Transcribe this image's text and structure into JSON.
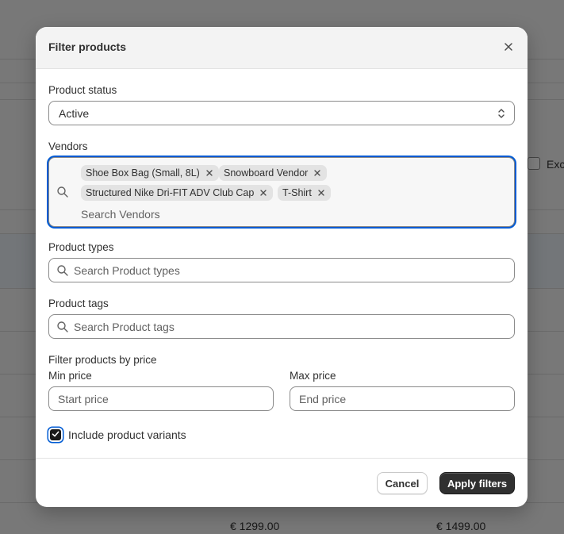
{
  "background": {
    "partial_label": "Exc",
    "prices": [
      "€ 1299.00",
      "€ 1499.00"
    ]
  },
  "modal": {
    "title": "Filter products",
    "close_icon": "close-icon",
    "product_status": {
      "label": "Product status",
      "value": "Active"
    },
    "vendors": {
      "label": "Vendors",
      "tags": [
        "Shoe Box Bag (Small, 8L)",
        "Snowboard Vendor",
        "Structured Nike Dri-FIT ADV Club Cap",
        "T-Shirt"
      ],
      "placeholder": "Search Vendors"
    },
    "product_types": {
      "label": "Product types",
      "placeholder": "Search Product types"
    },
    "product_tags": {
      "label": "Product tags",
      "placeholder": "Search Product tags"
    },
    "price": {
      "section_label": "Filter products by price",
      "min_label": "Min price",
      "min_placeholder": "Start price",
      "max_label": "Max price",
      "max_placeholder": "End price"
    },
    "include_variants": {
      "label": "Include product variants",
      "checked": true
    },
    "buttons": {
      "cancel": "Cancel",
      "apply": "Apply filters"
    }
  },
  "colors": {
    "focus_ring": "#005bd3",
    "primary_button": "#303030",
    "overlay": "rgba(0,0,0,0.5)"
  }
}
